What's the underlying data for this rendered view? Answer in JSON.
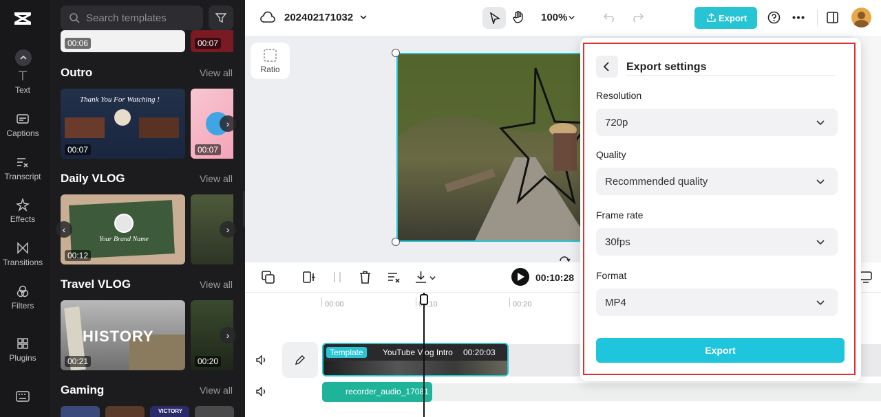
{
  "colors": {
    "accent": "#27c4d4",
    "highlight": "#e03131",
    "rail_bg": "#18181b",
    "panel_bg": "#1c1c1f"
  },
  "rail": {
    "items": [
      {
        "label": "Text",
        "icon": "text-icon"
      },
      {
        "label": "Captions",
        "icon": "captions-icon"
      },
      {
        "label": "Transcript",
        "icon": "transcript-icon"
      },
      {
        "label": "Effects",
        "icon": "effects-icon"
      },
      {
        "label": "Transitions",
        "icon": "transitions-icon"
      },
      {
        "label": "Filters",
        "icon": "filters-icon"
      },
      {
        "label": "Plugins",
        "icon": "plugins-icon"
      }
    ]
  },
  "panel": {
    "search_placeholder": "Search templates",
    "top_row": {
      "durations": [
        "00:06",
        "00:07"
      ]
    },
    "sections": [
      {
        "title": "Outro",
        "view_all": "View all",
        "cards": [
          {
            "duration": "00:07",
            "text": "Thank You For Watching !"
          },
          {
            "duration": "00:07"
          }
        ]
      },
      {
        "title": "Daily VLOG",
        "view_all": "View all",
        "cards": [
          {
            "duration": "00:12",
            "text": "Your Brand Name"
          },
          {
            "duration": ""
          }
        ]
      },
      {
        "title": "Travel VLOG",
        "view_all": "View all",
        "cards": [
          {
            "duration": "00:21",
            "text": "HISTORY"
          },
          {
            "duration": "00:20"
          }
        ]
      },
      {
        "title": "Gaming",
        "view_all": "View all",
        "cards": [
          {
            "text": "VICTORY"
          }
        ]
      }
    ]
  },
  "topbar": {
    "project_name": "202402171032",
    "zoom": "100%",
    "export_label": "Export"
  },
  "canvas": {
    "ratio_label": "Ratio"
  },
  "timeline": {
    "timecode": "00:10:28",
    "ruler": [
      "00:00",
      "00:10",
      "00:20"
    ],
    "clip": {
      "tag": "Template",
      "title": "YouTube Vlog Intro",
      "time": "00:20:03"
    },
    "audio_clip": "recorder_audio_17081"
  },
  "export_modal": {
    "title": "Export settings",
    "resolution": {
      "label": "Resolution",
      "value": "720p"
    },
    "quality": {
      "label": "Quality",
      "value": "Recommended quality"
    },
    "frame_rate": {
      "label": "Frame rate",
      "value": "30fps"
    },
    "format": {
      "label": "Format",
      "value": "MP4"
    },
    "export_button": "Export"
  }
}
